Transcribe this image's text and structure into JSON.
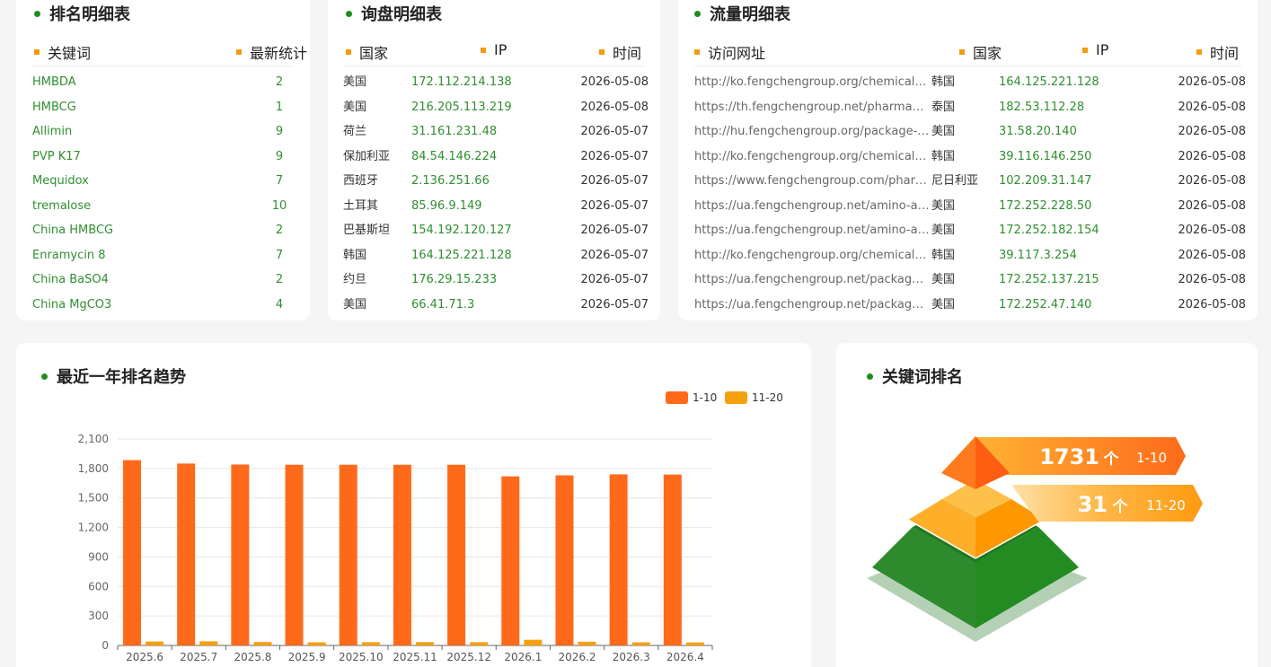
{
  "ranking_table": {
    "title": "排名明细表",
    "col_keyword": "关键词",
    "col_stat": "最新统计",
    "rows": [
      {
        "keyword": "HMBDA",
        "count": "2"
      },
      {
        "keyword": "HMBCG",
        "count": "1"
      },
      {
        "keyword": "Allimin",
        "count": "9"
      },
      {
        "keyword": "PVP K17",
        "count": "9"
      },
      {
        "keyword": "Mequidox",
        "count": "7"
      },
      {
        "keyword": "tremalose",
        "count": "10"
      },
      {
        "keyword": "China HMBCG",
        "count": "2"
      },
      {
        "keyword": "Enramycin 8",
        "count": "7"
      },
      {
        "keyword": "China BaSO4",
        "count": "2"
      },
      {
        "keyword": "China MgCO3",
        "count": "4"
      }
    ]
  },
  "inquiry_table": {
    "title": "询盘明细表",
    "col_country": "国家",
    "col_ip": "IP",
    "col_time": "时间",
    "rows": [
      {
        "country": "美国",
        "ip": "172.112.214.138",
        "time": "2026-05-08"
      },
      {
        "country": "美国",
        "ip": "216.205.113.219",
        "time": "2026-05-08"
      },
      {
        "country": "荷兰",
        "ip": "31.161.231.48",
        "time": "2026-05-07"
      },
      {
        "country": "保加利亚",
        "ip": "84.54.146.224",
        "time": "2026-05-07"
      },
      {
        "country": "西班牙",
        "ip": "2.136.251.66",
        "time": "2026-05-07"
      },
      {
        "country": "土耳其",
        "ip": "85.96.9.149",
        "time": "2026-05-07"
      },
      {
        "country": "巴基斯坦",
        "ip": "154.192.120.127",
        "time": "2026-05-07"
      },
      {
        "country": "韩国",
        "ip": "164.125.221.128",
        "time": "2026-05-07"
      },
      {
        "country": "约旦",
        "ip": "176.29.15.233",
        "time": "2026-05-07"
      },
      {
        "country": "美国",
        "ip": "66.41.71.3",
        "time": "2026-05-07"
      }
    ]
  },
  "traffic_table": {
    "title": "流量明细表",
    "col_url": "访问网址",
    "col_country": "国家",
    "col_ip": "IP",
    "col_time": "时间",
    "rows": [
      {
        "url": "http://ko.fengchengroup.org/chemicals/…",
        "country": "韩国",
        "ip": "164.125.221.128",
        "time": "2026-05-08"
      },
      {
        "url": "https://th.fengchengroup.net/pharmace…",
        "country": "泰国",
        "ip": "182.53.112.28",
        "time": "2026-05-08"
      },
      {
        "url": "http://hu.fengchengroup.org/package-…",
        "country": "美国",
        "ip": "31.58.20.140",
        "time": "2026-05-08"
      },
      {
        "url": "http://ko.fengchengroup.org/chemicals/…",
        "country": "韩国",
        "ip": "39.116.146.250",
        "time": "2026-05-08"
      },
      {
        "url": "https://www.fengchengroup.com/pharm…",
        "country": "尼日利亚",
        "ip": "102.209.31.147",
        "time": "2026-05-08"
      },
      {
        "url": "https://ua.fengchengroup.net/amino-aci…",
        "country": "美国",
        "ip": "172.252.228.50",
        "time": "2026-05-08"
      },
      {
        "url": "https://ua.fengchengroup.net/amino-aci…",
        "country": "美国",
        "ip": "172.252.182.154",
        "time": "2026-05-08"
      },
      {
        "url": "http://ko.fengchengroup.org/chemicals/…",
        "country": "韩国",
        "ip": "39.117.3.254",
        "time": "2026-05-08"
      },
      {
        "url": "https://ua.fengchengroup.net/package-…",
        "country": "美国",
        "ip": "172.252.137.215",
        "time": "2026-05-08"
      },
      {
        "url": "https://ua.fengchengroup.net/package-…",
        "country": "美国",
        "ip": "172.252.47.140",
        "time": "2026-05-08"
      }
    ]
  },
  "trend_chart": {
    "title": "最近一年排名趋势"
  },
  "chart_data": {
    "type": "bar",
    "categories": [
      "2025.6",
      "2025.7",
      "2025.8",
      "2025.9",
      "2025.10",
      "2025.11",
      "2025.12",
      "2026.1",
      "2026.2",
      "2026.3",
      "2026.4"
    ],
    "series": [
      {
        "name": "1-10",
        "color": "#ff6a1a",
        "values": [
          1885,
          1850,
          1840,
          1838,
          1838,
          1838,
          1838,
          1720,
          1730,
          1740,
          1738
        ]
      },
      {
        "name": "11-20",
        "color": "#f5a00f",
        "values": [
          40,
          42,
          35,
          32,
          33,
          34,
          33,
          58,
          38,
          32,
          31
        ]
      }
    ],
    "yticks": [
      "0",
      "300",
      "600",
      "900",
      "1,200",
      "1,500",
      "1,800",
      "2,100"
    ],
    "ylim": [
      0,
      2100
    ],
    "grid": true,
    "legend": "top-right"
  },
  "keyword_rank": {
    "title": "关键词排名",
    "top_count": "1731",
    "top_unit": "个",
    "top_range": "1-10",
    "second_count": "31",
    "second_unit": "个",
    "second_range": "11-20",
    "colors": {
      "orange": "#ff7a1c",
      "amber": "#ffa31a",
      "green": "#2a8f2a"
    }
  }
}
